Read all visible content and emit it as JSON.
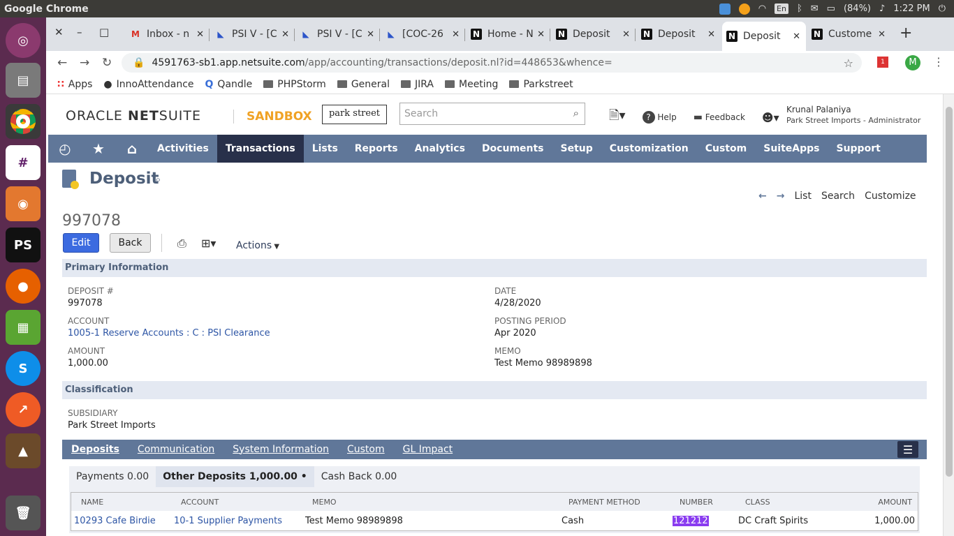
{
  "os": {
    "app_title": "Google Chrome",
    "battery": "(84%)",
    "time": "1:22 PM",
    "lang": "En"
  },
  "tabs": [
    {
      "label": "Inbox - n",
      "favicon": "gmail-icon"
    },
    {
      "label": "PSI V - [C",
      "favicon": "jira-icon"
    },
    {
      "label": "PSI V - [C",
      "favicon": "jira-icon"
    },
    {
      "label": "[COC-26",
      "favicon": "jira-icon"
    },
    {
      "label": "Home - N",
      "favicon": "netsuite-icon"
    },
    {
      "label": "Deposit",
      "favicon": "netsuite-icon"
    },
    {
      "label": "Deposit",
      "favicon": "netsuite-icon"
    },
    {
      "label": "Deposit",
      "favicon": "netsuite-icon",
      "active": true
    },
    {
      "label": "Custome",
      "favicon": "netsuite-icon"
    }
  ],
  "url": {
    "host": "4591763-sb1.app.netsuite.com",
    "path": "/app/accounting/transactions/deposit.nl?id=448653&whence="
  },
  "bookmarks": [
    {
      "label": "Apps",
      "icon": "apps-grid-icon"
    },
    {
      "label": "InnoAttendance",
      "icon": "globe-icon"
    },
    {
      "label": "Qandle",
      "icon": "qandle-icon"
    },
    {
      "label": "PHPStorm",
      "icon": "folder-icon"
    },
    {
      "label": "General",
      "icon": "folder-icon"
    },
    {
      "label": "JIRA",
      "icon": "folder-icon"
    },
    {
      "label": "Meeting",
      "icon": "folder-icon"
    },
    {
      "label": "Parkstreet",
      "icon": "folder-icon"
    }
  ],
  "profile_initial": "M",
  "ext_badge": "1",
  "header": {
    "logo_a": "ORACLE ",
    "logo_b": "NET",
    "logo_c": "SUITE",
    "sandbox": "SANDBOX",
    "partner_logo": "park street",
    "search_placeholder": "Search",
    "help": "Help",
    "feedback": "Feedback",
    "user_name": "Krunal Palaniya",
    "user_role": "Park Street Imports - Administrator"
  },
  "menu": [
    "Activities",
    "Transactions",
    "Lists",
    "Reports",
    "Analytics",
    "Documents",
    "Setup",
    "Customization",
    "Custom",
    "SuiteApps",
    "Support"
  ],
  "record": {
    "type": "Deposit",
    "number": "997078",
    "edit": "Edit",
    "back": "Back",
    "actions": "Actions",
    "nav_list": "List",
    "nav_search": "Search",
    "nav_customize": "Customize"
  },
  "primary": {
    "title": "Primary Information",
    "deposit_label": "DEPOSIT #",
    "deposit_value": "997078",
    "account_label": "ACCOUNT",
    "account_value": "1005-1 Reserve Accounts : C : PSI Clearance",
    "amount_label": "AMOUNT",
    "amount_value": "1,000.00",
    "date_label": "DATE",
    "date_value": "4/28/2020",
    "period_label": "POSTING PERIOD",
    "period_value": "Apr 2020",
    "memo_label": "MEMO",
    "memo_value": "Test Memo 98989898"
  },
  "classification": {
    "title": "Classification",
    "subsidiary_label": "SUBSIDIARY",
    "subsidiary_value": "Park Street Imports"
  },
  "subtabs": [
    "Deposits",
    "Communication",
    "System Information",
    "Custom",
    "GL Impact"
  ],
  "pills": [
    "Payments 0.00",
    "Other Deposits 1,000.00 •",
    "Cash Back 0.00"
  ],
  "grid": {
    "headers": [
      "NAME",
      "ACCOUNT",
      "MEMO",
      "PAYMENT METHOD",
      "NUMBER",
      "CLASS",
      "AMOUNT"
    ],
    "rows": [
      [
        "10293 Cafe Birdie",
        "10-1 Supplier Payments",
        "Test Memo 98989898",
        "Cash",
        "121212",
        "DC Craft Spirits",
        "1,000.00"
      ]
    ]
  }
}
